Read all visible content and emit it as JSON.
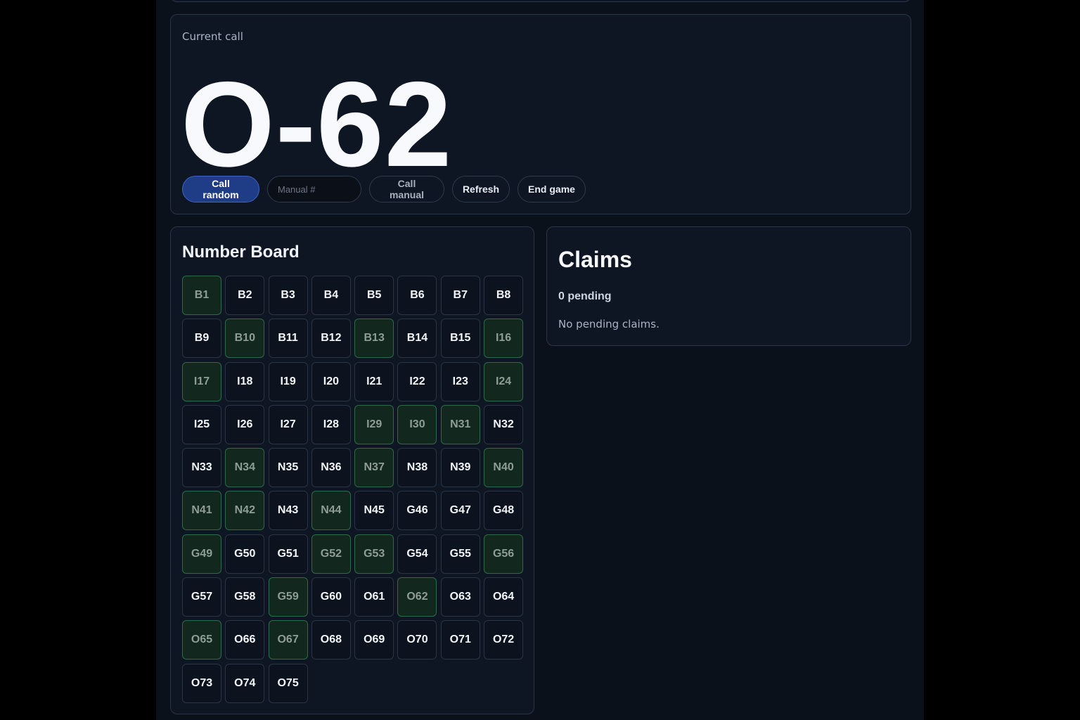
{
  "current_call": {
    "label": "Current call",
    "value": "O-62"
  },
  "controls": {
    "call_random": "Call random",
    "manual_placeholder": "Manual #",
    "manual_value": "",
    "call_manual": "Call manual",
    "refresh": "Refresh",
    "end_game": "End game"
  },
  "board": {
    "title": "Number Board",
    "called_color": "#12281f",
    "cells": [
      {
        "label": "B1",
        "called": true
      },
      {
        "label": "B2",
        "called": false
      },
      {
        "label": "B3",
        "called": false
      },
      {
        "label": "B4",
        "called": false
      },
      {
        "label": "B5",
        "called": false
      },
      {
        "label": "B6",
        "called": false
      },
      {
        "label": "B7",
        "called": false
      },
      {
        "label": "B8",
        "called": false
      },
      {
        "label": "B9",
        "called": false
      },
      {
        "label": "B10",
        "called": true
      },
      {
        "label": "B11",
        "called": false
      },
      {
        "label": "B12",
        "called": false
      },
      {
        "label": "B13",
        "called": true
      },
      {
        "label": "B14",
        "called": false
      },
      {
        "label": "B15",
        "called": false
      },
      {
        "label": "I16",
        "called": true
      },
      {
        "label": "I17",
        "called": true
      },
      {
        "label": "I18",
        "called": false
      },
      {
        "label": "I19",
        "called": false
      },
      {
        "label": "I20",
        "called": false
      },
      {
        "label": "I21",
        "called": false
      },
      {
        "label": "I22",
        "called": false
      },
      {
        "label": "I23",
        "called": false
      },
      {
        "label": "I24",
        "called": true
      },
      {
        "label": "I25",
        "called": false
      },
      {
        "label": "I26",
        "called": false
      },
      {
        "label": "I27",
        "called": false
      },
      {
        "label": "I28",
        "called": false
      },
      {
        "label": "I29",
        "called": true
      },
      {
        "label": "I30",
        "called": true
      },
      {
        "label": "N31",
        "called": true
      },
      {
        "label": "N32",
        "called": false
      },
      {
        "label": "N33",
        "called": false
      },
      {
        "label": "N34",
        "called": true
      },
      {
        "label": "N35",
        "called": false
      },
      {
        "label": "N36",
        "called": false
      },
      {
        "label": "N37",
        "called": true
      },
      {
        "label": "N38",
        "called": false
      },
      {
        "label": "N39",
        "called": false
      },
      {
        "label": "N40",
        "called": true
      },
      {
        "label": "N41",
        "called": true
      },
      {
        "label": "N42",
        "called": true
      },
      {
        "label": "N43",
        "called": false
      },
      {
        "label": "N44",
        "called": true
      },
      {
        "label": "N45",
        "called": false
      },
      {
        "label": "G46",
        "called": false
      },
      {
        "label": "G47",
        "called": false
      },
      {
        "label": "G48",
        "called": false
      },
      {
        "label": "G49",
        "called": true
      },
      {
        "label": "G50",
        "called": false
      },
      {
        "label": "G51",
        "called": false
      },
      {
        "label": "G52",
        "called": true
      },
      {
        "label": "G53",
        "called": true
      },
      {
        "label": "G54",
        "called": false
      },
      {
        "label": "G55",
        "called": false
      },
      {
        "label": "G56",
        "called": true
      },
      {
        "label": "G57",
        "called": false
      },
      {
        "label": "G58",
        "called": false
      },
      {
        "label": "G59",
        "called": true
      },
      {
        "label": "G60",
        "called": false
      },
      {
        "label": "O61",
        "called": false
      },
      {
        "label": "O62",
        "called": true
      },
      {
        "label": "O63",
        "called": false
      },
      {
        "label": "O64",
        "called": false
      },
      {
        "label": "O65",
        "called": true
      },
      {
        "label": "O66",
        "called": false
      },
      {
        "label": "O67",
        "called": true
      },
      {
        "label": "O68",
        "called": false
      },
      {
        "label": "O69",
        "called": false
      },
      {
        "label": "O70",
        "called": false
      },
      {
        "label": "O71",
        "called": false
      },
      {
        "label": "O72",
        "called": false
      },
      {
        "label": "O73",
        "called": false
      },
      {
        "label": "O74",
        "called": false
      },
      {
        "label": "O75",
        "called": false
      }
    ]
  },
  "claims": {
    "title": "Claims",
    "pending": "0 pending",
    "empty_message": "No pending claims."
  }
}
